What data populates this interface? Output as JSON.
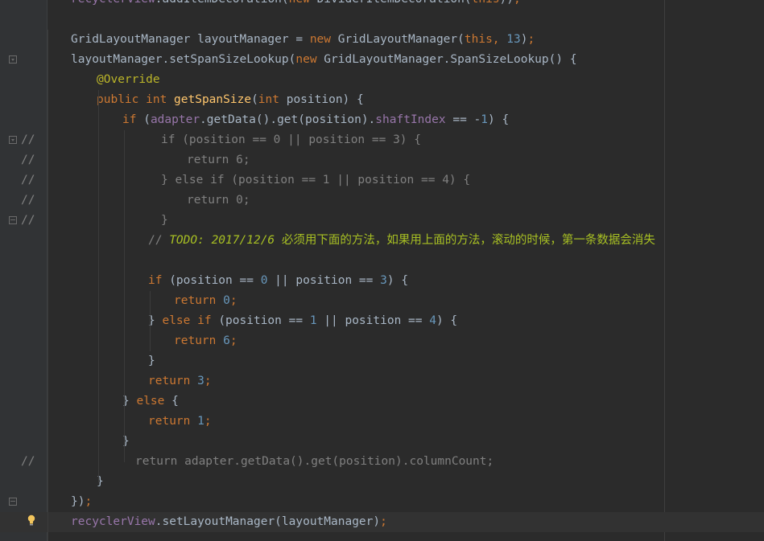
{
  "editor": {
    "lines": [
      {
        "tokens": [
          [
            "field",
            "recyclerView"
          ],
          [
            "",
            "."
          ],
          [
            "",
            "addItemDecoration"
          ],
          [
            "",
            "("
          ],
          [
            "kw",
            "new "
          ],
          [
            "",
            "DividerItemDecoration"
          ],
          [
            "",
            "("
          ],
          [
            "kw",
            "this"
          ],
          [
            "",
            "))"
          ],
          [
            "punct",
            ";"
          ]
        ]
      },
      {
        "tokens": []
      },
      {
        "tokens": [
          [
            "",
            "GridLayoutManager layoutManager = "
          ],
          [
            "kw",
            "new "
          ],
          [
            "",
            "GridLayoutManager("
          ],
          [
            "kw",
            "this"
          ],
          [
            "punct",
            ", "
          ],
          [
            "num",
            "13"
          ],
          [
            "",
            ")"
          ],
          [
            "punct",
            ";"
          ]
        ]
      },
      {
        "tokens": [
          [
            "",
            "layoutManager.setSpanSizeLookup("
          ],
          [
            "kw",
            "new "
          ],
          [
            "",
            "GridLayoutManager.SpanSizeLookup() {"
          ]
        ]
      },
      {
        "tokens": [
          [
            "anno",
            "@Override"
          ]
        ]
      },
      {
        "tokens": [
          [
            "kw",
            "public int "
          ],
          [
            "method",
            "getSpanSize"
          ],
          [
            "",
            "("
          ],
          [
            "kw",
            "int "
          ],
          [
            "",
            "position) {"
          ]
        ]
      },
      {
        "tokens": [
          [
            "kw",
            "if "
          ],
          [
            "",
            "("
          ],
          [
            "field",
            "adapter"
          ],
          [
            "",
            ".getData().get(position)."
          ],
          [
            "field",
            "shaftIndex"
          ],
          [
            "",
            " == -"
          ],
          [
            "num",
            "1"
          ],
          [
            "",
            ") {"
          ]
        ]
      },
      {
        "prefix": "//",
        "tokens": [
          [
            "cmt",
            "if (position == 0 || position == 3) {"
          ]
        ]
      },
      {
        "prefix": "//",
        "tokens": [
          [
            "cmt",
            "return 6;"
          ]
        ]
      },
      {
        "prefix": "//",
        "tokens": [
          [
            "cmt",
            "} else if (position == 1 || position == 4) {"
          ]
        ]
      },
      {
        "prefix": "//",
        "tokens": [
          [
            "cmt",
            "return 0;"
          ]
        ]
      },
      {
        "prefix": "//",
        "tokens": [
          [
            "cmt",
            "}"
          ]
        ]
      },
      {
        "tokens": [
          [
            "cmt",
            "// "
          ],
          [
            "todo",
            "TODO: 2017/12/6 "
          ],
          [
            "todo-cjk",
            "必须用下面的方法，如果用上面的方法，滚动的时候，第一条数据会消失"
          ]
        ]
      },
      {
        "tokens": []
      },
      {
        "tokens": [
          [
            "kw",
            "if "
          ],
          [
            "",
            "(position == "
          ],
          [
            "num",
            "0"
          ],
          [
            "",
            " || position == "
          ],
          [
            "num",
            "3"
          ],
          [
            "",
            ") {"
          ]
        ]
      },
      {
        "tokens": [
          [
            "kw",
            "return "
          ],
          [
            "num",
            "0"
          ],
          [
            "punct",
            ";"
          ]
        ]
      },
      {
        "tokens": [
          [
            "",
            "} "
          ],
          [
            "kw",
            "else if "
          ],
          [
            "",
            "(position == "
          ],
          [
            "num",
            "1"
          ],
          [
            "",
            " || position == "
          ],
          [
            "num",
            "4"
          ],
          [
            "",
            ") {"
          ]
        ]
      },
      {
        "tokens": [
          [
            "kw",
            "return "
          ],
          [
            "num",
            "6"
          ],
          [
            "punct",
            ";"
          ]
        ]
      },
      {
        "tokens": [
          [
            "",
            "}"
          ]
        ]
      },
      {
        "tokens": [
          [
            "kw",
            "return "
          ],
          [
            "num",
            "3"
          ],
          [
            "punct",
            ";"
          ]
        ]
      },
      {
        "tokens": [
          [
            "",
            "} "
          ],
          [
            "kw",
            "else "
          ],
          [
            "",
            "{"
          ]
        ]
      },
      {
        "tokens": [
          [
            "kw",
            "return "
          ],
          [
            "num",
            "1"
          ],
          [
            "punct",
            ";"
          ]
        ]
      },
      {
        "tokens": [
          [
            "",
            "}"
          ]
        ]
      },
      {
        "prefix": "//",
        "tokens": [
          [
            "cmt",
            "return adapter.getData().get(position).columnCount;"
          ]
        ]
      },
      {
        "tokens": [
          [
            "",
            "}"
          ]
        ]
      },
      {
        "tokens": [
          [
            "",
            "})"
          ],
          [
            "punct",
            ";"
          ]
        ]
      },
      {
        "tokens": [
          [
            "field",
            "recyclerView"
          ],
          [
            "",
            ".setLayoutManager(layoutManager)"
          ],
          [
            "punct",
            ";"
          ]
        ]
      }
    ]
  },
  "gutter_icons": {
    "fold_icon": "fold-marker-icon",
    "intention": "lightbulb-icon"
  },
  "colors": {
    "background": "#2b2b2b",
    "keyword": "#cc7832",
    "number": "#6897bb",
    "annotation": "#bbb529",
    "field": "#9876aa",
    "method": "#ffc66d",
    "comment": "#808080",
    "todo": "#a8c023"
  }
}
